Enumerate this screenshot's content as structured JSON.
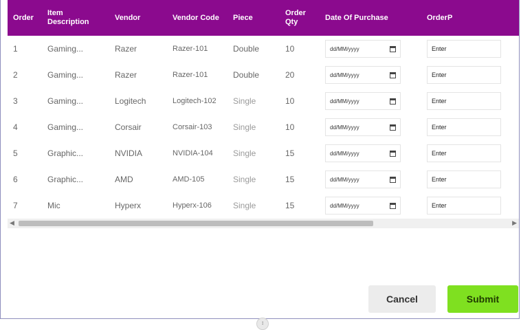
{
  "headers": [
    "Order",
    "Item Description",
    "Vendor",
    "Vendor Code",
    "Piece",
    "Order Qty",
    "Date Of Purchase",
    "OrderP"
  ],
  "rows": [
    {
      "order": "1",
      "item": "Gaming...",
      "vendor": "Razer",
      "code": "Razer-101",
      "piece": "Double",
      "qty": "10",
      "date": "dd/MM/yyyy",
      "orderp": "Enter"
    },
    {
      "order": "2",
      "item": "Gaming...",
      "vendor": "Razer",
      "code": "Razer-101",
      "piece": "Double",
      "qty": "20",
      "date": "dd/MM/yyyy",
      "orderp": "Enter"
    },
    {
      "order": "3",
      "item": "Gaming...",
      "vendor": "Logitech",
      "code": "Logitech-102",
      "piece": "Single",
      "qty": "10",
      "date": "dd/MM/yyyy",
      "orderp": "Enter"
    },
    {
      "order": "4",
      "item": "Gaming...",
      "vendor": "Corsair",
      "code": "Corsair-103",
      "piece": "Single",
      "qty": "10",
      "date": "dd/MM/yyyy",
      "orderp": "Enter"
    },
    {
      "order": "5",
      "item": "Graphic...",
      "vendor": "NVIDIA",
      "code": "NVIDIA-104",
      "piece": "Single",
      "qty": "15",
      "date": "dd/MM/yyyy",
      "orderp": "Enter"
    },
    {
      "order": "6",
      "item": "Graphic...",
      "vendor": "AMD",
      "code": "AMD-105",
      "piece": "Single",
      "qty": "15",
      "date": "dd/MM/yyyy",
      "orderp": "Enter"
    },
    {
      "order": "7",
      "item": "Mic",
      "vendor": "Hyperx",
      "code": "Hyperx-106",
      "piece": "Single",
      "qty": "15",
      "date": "dd/MM/yyyy",
      "orderp": "Enter"
    }
  ],
  "buttons": {
    "cancel": "Cancel",
    "submit": "Submit"
  },
  "colors": {
    "header_bg": "#8b0a8e",
    "submit_bg": "#7fe020",
    "cancel_bg": "#ececec"
  }
}
